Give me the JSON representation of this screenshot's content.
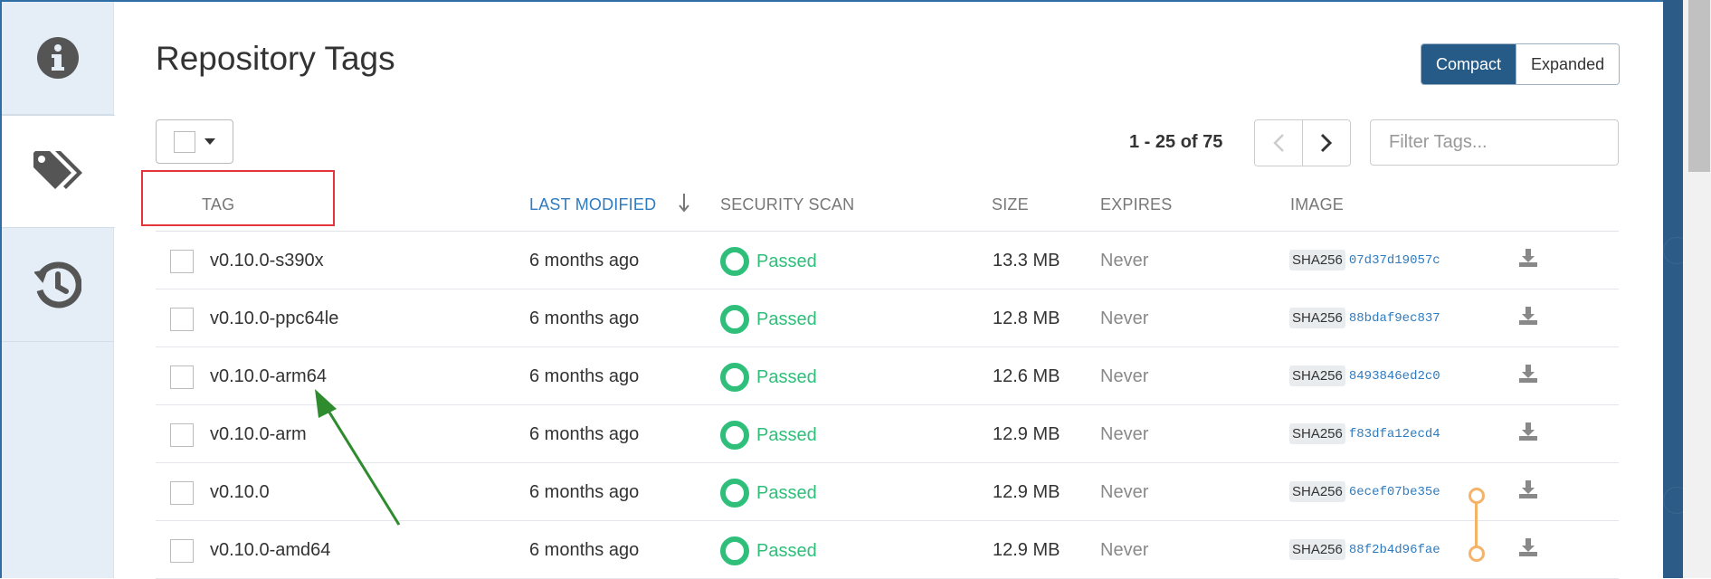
{
  "page": {
    "title": "Repository Tags"
  },
  "sidebar": {
    "items": [
      {
        "icon": "info-icon"
      },
      {
        "icon": "tags-icon",
        "active": true
      },
      {
        "icon": "history-icon"
      }
    ]
  },
  "view_toggle": {
    "compact_label": "Compact",
    "expanded_label": "Expanded",
    "selected": "Compact"
  },
  "toolbar": {
    "paging_text": "1 - 25 of 75",
    "filter_placeholder": "Filter Tags...",
    "filter_value": ""
  },
  "table": {
    "headers": {
      "tag": "TAG",
      "last_modified": "LAST MODIFIED",
      "security_scan": "SECURITY SCAN",
      "size": "SIZE",
      "expires": "EXPIRES",
      "image": "IMAGE"
    },
    "sorted_by": "last_modified",
    "rows": [
      {
        "tag": "v0.10.0-s390x",
        "modified": "6 months ago",
        "scan": "Passed",
        "size": "13.3 MB",
        "expires": "Never",
        "sha_label": "SHA256",
        "hash": "07d37d19057c"
      },
      {
        "tag": "v0.10.0-ppc64le",
        "modified": "6 months ago",
        "scan": "Passed",
        "size": "12.8 MB",
        "expires": "Never",
        "sha_label": "SHA256",
        "hash": "88bdaf9ec837"
      },
      {
        "tag": "v0.10.0-arm64",
        "modified": "6 months ago",
        "scan": "Passed",
        "size": "12.6 MB",
        "expires": "Never",
        "sha_label": "SHA256",
        "hash": "8493846ed2c0"
      },
      {
        "tag": "v0.10.0-arm",
        "modified": "6 months ago",
        "scan": "Passed",
        "size": "12.9 MB",
        "expires": "Never",
        "sha_label": "SHA256",
        "hash": "f83dfa12ecd4"
      },
      {
        "tag": "v0.10.0",
        "modified": "6 months ago",
        "scan": "Passed",
        "size": "12.9 MB",
        "expires": "Never",
        "sha_label": "SHA256",
        "hash": "6ecef07be35e"
      },
      {
        "tag": "v0.10.0-amd64",
        "modified": "6 months ago",
        "scan": "Passed",
        "size": "12.9 MB",
        "expires": "Never",
        "sha_label": "SHA256",
        "hash": "88f2b4d96fae"
      }
    ]
  },
  "colors": {
    "accent": "#265a87",
    "link": "#2f7bbf",
    "passed": "#2fbf7a",
    "annotation_box": "#e3353a",
    "annotation_arrow": "#2e8b2e",
    "image_link": "#f5b36a"
  }
}
